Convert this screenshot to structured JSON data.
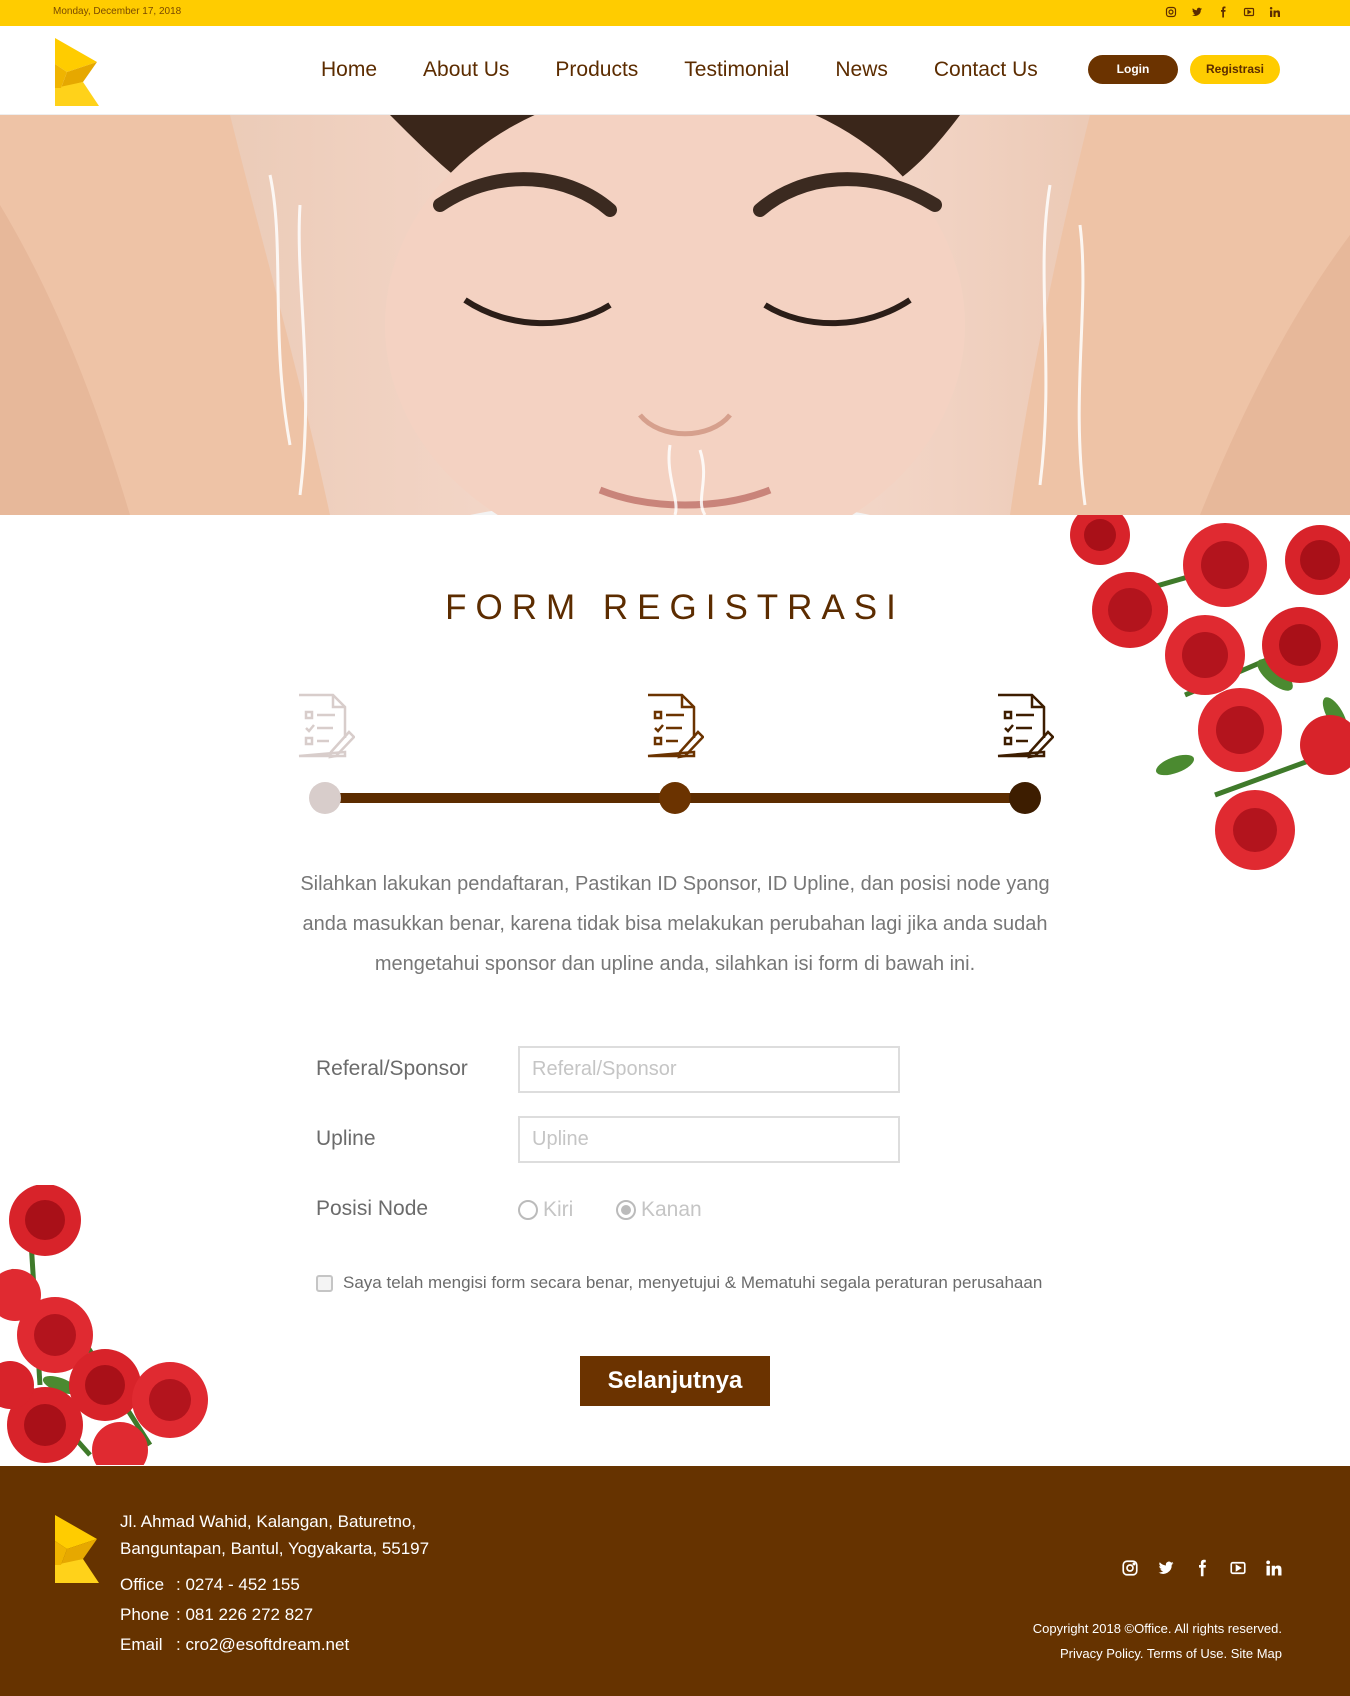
{
  "topbar": {
    "date": "Monday, December 17, 2018",
    "social_icons": [
      "instagram-icon",
      "twitter-icon",
      "facebook-icon",
      "youtube-icon",
      "linkedin-icon"
    ]
  },
  "header": {
    "nav": [
      "Home",
      "About Us",
      "Products",
      "Testimonial",
      "News",
      "Contact Us"
    ],
    "login_label": "Login",
    "register_label": "Registrasi"
  },
  "main": {
    "title": "FORM REGISTRASI",
    "steps": [
      {
        "icon": "form-document-icon",
        "state": "done"
      },
      {
        "icon": "form-document-icon",
        "state": "current"
      },
      {
        "icon": "form-document-icon",
        "state": "pending"
      }
    ],
    "intro": "Silahkan lakukan pendaftaran, Pastikan ID Sponsor, ID Upline, dan posisi node yang anda masukkan benar, karena tidak bisa melakukan perubahan lagi jika anda sudah mengetahui sponsor dan upline anda, silahkan isi form di bawah ini.",
    "fields": {
      "sponsor": {
        "label": "Referal/Sponsor",
        "placeholder": "Referal/Sponsor",
        "value": ""
      },
      "upline": {
        "label": "Upline",
        "placeholder": "Upline",
        "value": ""
      },
      "node": {
        "label": "Posisi Node",
        "options": [
          "Kiri",
          "Kanan"
        ],
        "selected": "Kanan"
      }
    },
    "agreement": "Saya telah mengisi form secara benar, menyetujui & Mematuhi segala peraturan perusahaan",
    "submit_label": "Selanjutnya"
  },
  "footer": {
    "address_line1": "Jl. Ahmad Wahid, Kalangan, Baturetno,",
    "address_line2": "Banguntapan, Bantul, Yogyakarta, 55197",
    "contacts": [
      {
        "key": "Office",
        "value": ": 0274 - 452 155"
      },
      {
        "key": "Phone",
        "value": ": 081 226 272 827"
      },
      {
        "key": "Email",
        "value": ": cro2@esoftdream.net"
      }
    ],
    "copyright": "Copyright 2018 ©Office. All rights reserved.",
    "links": "Privacy Policy. Terms of Use. Site Map"
  },
  "colors": {
    "brand_brown": "#663300",
    "brand_yellow": "#ffcc00",
    "step_done": "#d8cdcb",
    "step_current": "#6b3300",
    "step_pending": "#3d1d00"
  }
}
